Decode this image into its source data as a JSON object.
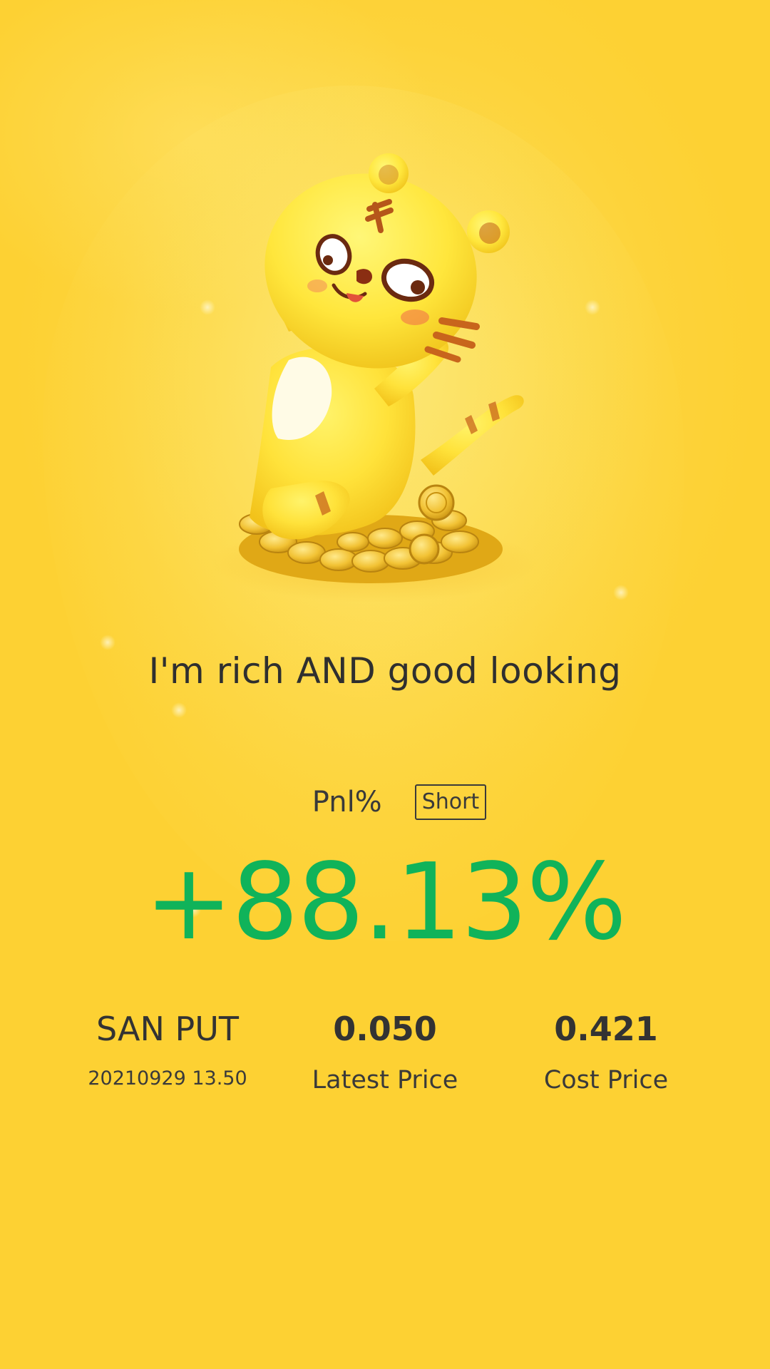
{
  "mascot": {
    "description_icon": "tiger-mascot-on-coins-icon"
  },
  "tagline": "I'm rich AND good looking",
  "pnl": {
    "label": "Pnl%",
    "direction_badge": "Short",
    "value": "+88.13%",
    "value_color": "#10b35a"
  },
  "position": {
    "symbol": "SAN PUT",
    "expiry_time": "20210929 13.50",
    "latest_price": "0.050",
    "latest_price_label": "Latest Price",
    "cost_price": "0.421",
    "cost_price_label": "Cost Price"
  },
  "colors": {
    "background": "#fdd33a",
    "text": "#2f2f2f",
    "positive": "#10b35a"
  }
}
